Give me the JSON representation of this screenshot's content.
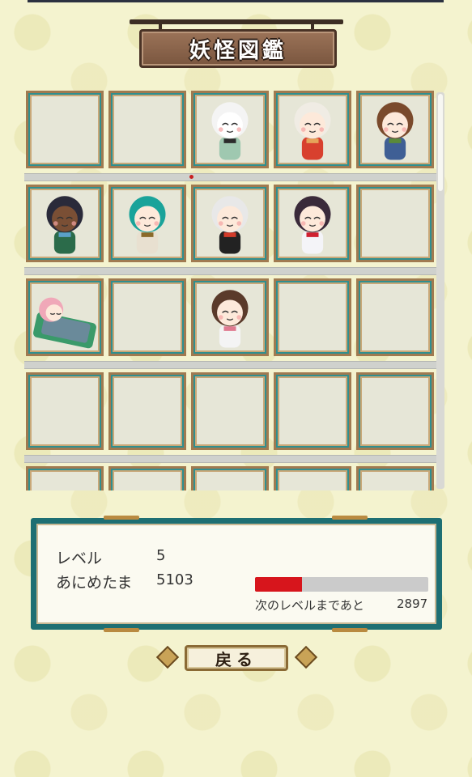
{
  "header": {
    "title": "妖怪図鑑"
  },
  "collection": {
    "rows": [
      [
        "empty",
        "empty",
        "umbrella-yokai",
        "fox-yokai",
        "tanuki-yokai"
      ],
      [
        "kappa-yokai",
        "green-hair-yokai",
        "oni-yokai",
        "nurse-yokai",
        "empty"
      ],
      [
        "sleeping-yokai",
        "empty",
        "mouse-ear-yokai",
        "empty",
        "empty"
      ],
      [
        "empty",
        "empty",
        "empty",
        "empty",
        "empty"
      ],
      [
        "empty",
        "empty",
        "empty",
        "empty",
        "empty"
      ]
    ]
  },
  "status": {
    "level_label": "レベル",
    "level_value": "5",
    "currency_label": "あにめたま",
    "currency_value": "5103",
    "next_label": "次のレベルまであと",
    "next_value": "2897",
    "progress": 0.27,
    "progress_color": "#d7151c"
  },
  "back_button": {
    "label": "戻る"
  }
}
